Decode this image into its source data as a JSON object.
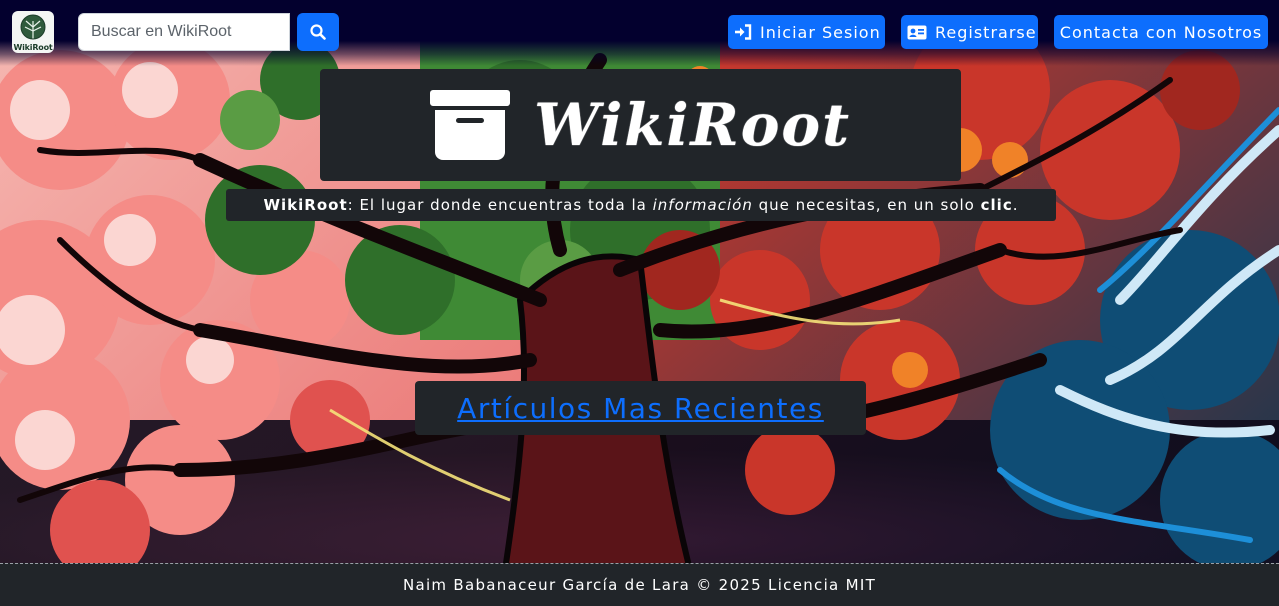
{
  "navbar": {
    "logo_text": "WikiRoot",
    "search": {
      "placeholder": "Buscar en WikiRoot",
      "value": ""
    },
    "search_button_icon": "search-icon",
    "buttons": [
      {
        "label": "Iniciar Sesion",
        "icon": "sign-in-icon"
      },
      {
        "label": "Registrarse",
        "icon": "id-card-icon"
      },
      {
        "label": "Contacta con Nosotros"
      }
    ]
  },
  "hero": {
    "title": "WikiRoot",
    "title_icon": "archive-box-icon",
    "tagline": {
      "brand": "WikiRoot",
      "part1": ": El lugar donde encuentras toda la ",
      "emphasis": "información",
      "part2": " que necesitas, en un solo ",
      "strong": "clic",
      "end": "."
    },
    "recent_articles_link": "Artículos Mas Recientes"
  },
  "footer": {
    "text": "Naim Babanaceur García de Lara © 2025 Licencia MIT"
  },
  "colors": {
    "navbar_bg": "#03002e",
    "primary": "#0d6efd",
    "panel_bg": "#212529",
    "tree_trunk": "#5a1418",
    "leaves_pink": "#f07c7a",
    "leaves_green": "#3f8a35",
    "leaves_red": "#d6402d",
    "ice_blue": "#1d8fd8"
  }
}
